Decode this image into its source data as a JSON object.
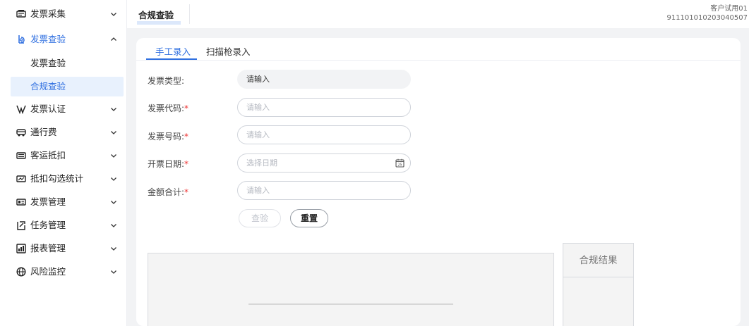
{
  "sidebar": {
    "items": [
      {
        "label": "发票采集",
        "icon": "invoice-collect-icon",
        "expanded": false
      },
      {
        "label": "发票查验",
        "icon": "invoice-check-icon",
        "expanded": true,
        "children": [
          {
            "label": "发票查验",
            "active": false
          },
          {
            "label": "合规查验",
            "active": true
          }
        ]
      },
      {
        "label": "发票认证",
        "icon": "certify-icon",
        "expanded": false
      },
      {
        "label": "通行费",
        "icon": "toll-icon",
        "expanded": false
      },
      {
        "label": "客运抵扣",
        "icon": "passenger-ticket-icon",
        "expanded": false
      },
      {
        "label": "抵扣勾选统计",
        "icon": "deduction-stats-icon",
        "expanded": false
      },
      {
        "label": "发票管理",
        "icon": "invoice-manage-icon",
        "expanded": false
      },
      {
        "label": "任务管理",
        "icon": "task-icon",
        "expanded": false
      },
      {
        "label": "报表管理",
        "icon": "report-icon",
        "expanded": false
      },
      {
        "label": "风险监控",
        "icon": "globe-risk-icon",
        "expanded": false
      }
    ]
  },
  "header": {
    "page_tab": "合规查验",
    "customer_name": "客户试用01",
    "customer_id": "911101010203040507"
  },
  "tabs": [
    {
      "label": "手工录入",
      "active": true
    },
    {
      "label": "扫描枪录入",
      "active": false
    }
  ],
  "form": {
    "invoice_type": {
      "label": "发票类型:",
      "placeholder": "请输入",
      "required": false
    },
    "invoice_code": {
      "label": "发票代码:",
      "placeholder": "请输入",
      "required": true
    },
    "invoice_number": {
      "label": "发票号码:",
      "placeholder": "请输入",
      "required": true
    },
    "issue_date": {
      "label": "开票日期:",
      "placeholder": "选择日期",
      "required": true
    },
    "total_amount": {
      "label": "金额合计:",
      "placeholder": "请输入",
      "required": true
    },
    "required_mark": "*"
  },
  "buttons": {
    "check": "查验",
    "reset": "重置"
  },
  "result": {
    "title": "合规结果"
  },
  "colors": {
    "accent": "#2f6fe0",
    "required": "#e33333",
    "active_bg": "#e8f1fd"
  }
}
